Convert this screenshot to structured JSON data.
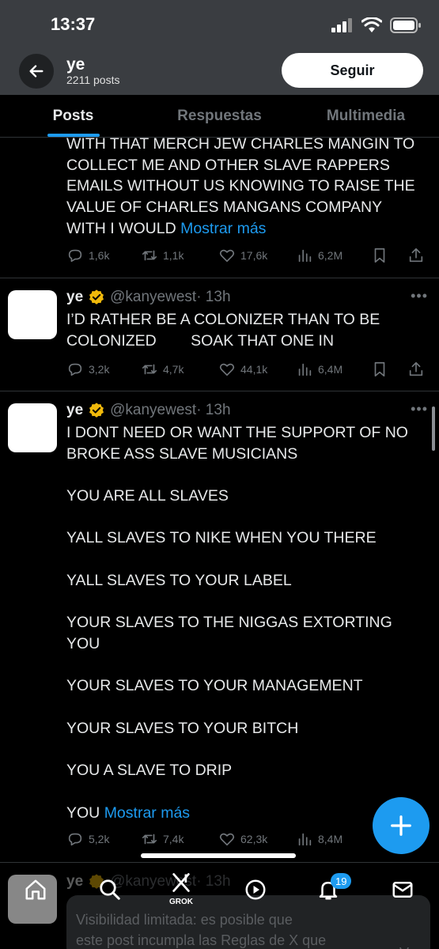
{
  "status_bar": {
    "time": "13:37"
  },
  "header": {
    "name": "ye",
    "posts_count": "2211 posts",
    "follow_label": "Seguir"
  },
  "tabs": [
    {
      "label": "Posts",
      "active": true
    },
    {
      "label": "Respuestas",
      "active": false
    },
    {
      "label": "Multimedia",
      "active": false
    }
  ],
  "tweet1": {
    "lines": [
      "WITH THAT MERCH JEW CHARLES MANGIN TO",
      "COLLECT ME AND OTHER SLAVE RAPPERS",
      "EMAILS WITHOUT US KNOWING TO RAISE THE",
      "VALUE OF CHARLES MANGANS COMPANY"
    ],
    "last_line": "WITH I WOULD",
    "more": "Mostrar más",
    "replies": "1,6k",
    "reposts": "1,1k",
    "likes": "17,6k",
    "views": "6,2M"
  },
  "tweet2": {
    "name": "ye",
    "handle": "@kanyewest",
    "time": "· 13h",
    "lines": [
      "I’D RATHER BE A COLONIZER THAN TO BE",
      "COLONIZED        SOAK THAT ONE IN"
    ],
    "replies": "3,2k",
    "reposts": "4,7k",
    "likes": "44,1k",
    "views": "6,4M"
  },
  "tweet3": {
    "name": "ye",
    "handle": "@kanyewest",
    "time": "· 13h",
    "paragraphs": [
      "I DONT NEED OR WANT THE SUPPORT OF NO",
      "BROKE ASS SLAVE MUSICIANS",
      "YOU ARE ALL SLAVES",
      "YALL SLAVES TO NIKE WHEN YOU THERE",
      "YALL SLAVES TO YOUR LABEL",
      "YOUR SLAVES TO THE NIGGAS EXTORTING",
      "YOU",
      "YOUR SLAVES TO YOUR MANAGEMENT",
      "YOUR SLAVES TO YOUR BITCH",
      "YOU A SLAVE TO DRIP"
    ],
    "last_line": "YOU",
    "more": "Mostrar más",
    "replies": "5,2k",
    "reposts": "7,4k",
    "likes": "62,3k",
    "views": "8,4M"
  },
  "tweet4": {
    "name": "ye",
    "handle": "@kanyewest",
    "time": "· 13h"
  },
  "bottom_nav": {
    "grok_label": "GROK",
    "notifications_badge": "19"
  },
  "notice": {
    "line1": "Visibilidad limitada: es posible que",
    "line2": "este post incumpla las Reglas de X que",
    "side": "Ver"
  },
  "colors": {
    "accent": "#1d9bf0",
    "verified": "#f0b90b",
    "muted": "#71767b"
  }
}
